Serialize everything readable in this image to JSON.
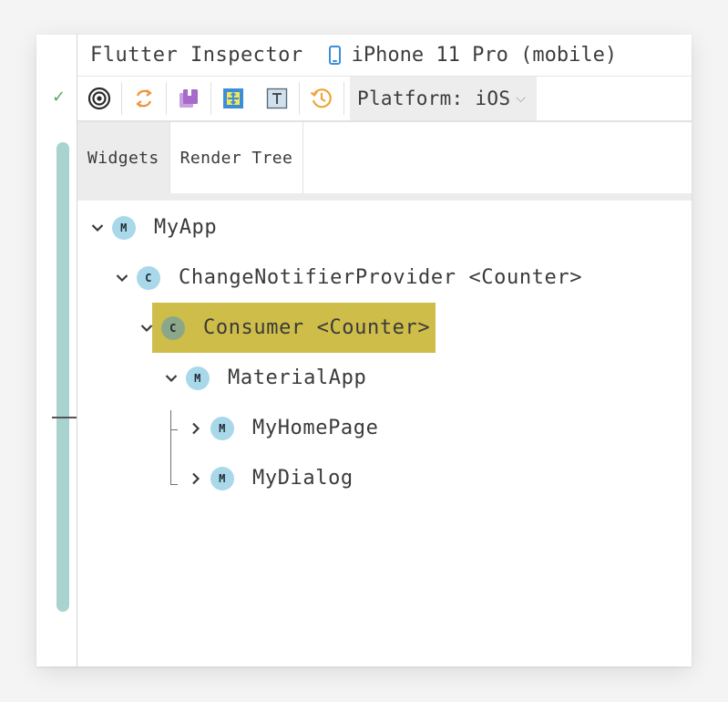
{
  "header": {
    "title": "Flutter Inspector",
    "device_name": "iPhone 11 Pro (mobile)",
    "device_icon": "phone-icon"
  },
  "toolbar": {
    "buttons": [
      {
        "icon": "select-widget-mode-icon"
      },
      {
        "icon": "refresh-tree-icon"
      },
      {
        "icon": "slow-animations-icon"
      },
      {
        "icon": "debug-paint-icon"
      },
      {
        "icon": "paint-baselines-icon"
      },
      {
        "icon": "repaint-rainbow-icon"
      }
    ],
    "platform_label": "Platform: iOS",
    "platform_chevron": "⌵"
  },
  "tabs": [
    {
      "label": "Widgets",
      "active": true
    },
    {
      "label": "Render Tree",
      "active": false
    }
  ],
  "tree": {
    "nodes": [
      {
        "badge": "M",
        "label": "MyApp",
        "expanded": true
      },
      {
        "badge": "C",
        "label": "ChangeNotifierProvider <Counter>",
        "expanded": true
      },
      {
        "badge": "C",
        "label": "Consumer <Counter>",
        "expanded": true,
        "selected": true
      },
      {
        "badge": "M",
        "label": "MaterialApp",
        "expanded": true
      },
      {
        "badge": "M",
        "label": "MyHomePage",
        "expanded": false
      },
      {
        "badge": "M",
        "label": "MyDialog",
        "expanded": false
      }
    ]
  },
  "gutter": {
    "check": "✓"
  },
  "colors": {
    "selection": "#cfbd4a",
    "badge": "#a8d8ea",
    "gutter_bar": "#a8d3cf",
    "accent_blue": "#3d8ed9"
  }
}
